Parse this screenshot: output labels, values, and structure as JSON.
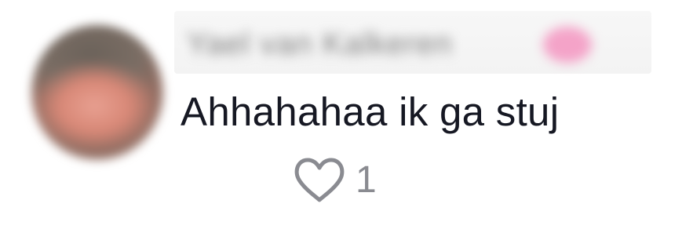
{
  "comment": {
    "author": {
      "display_name_blurred": "Yael van Kalkeren",
      "has_pink_emoji": true
    },
    "text": "Ahhahahaa ik ga stuj",
    "likes": {
      "icon": "heart-outline-icon",
      "count": "1"
    }
  },
  "colors": {
    "text_primary": "#161823",
    "text_secondary": "#8a8b91",
    "background": "#ffffff"
  }
}
